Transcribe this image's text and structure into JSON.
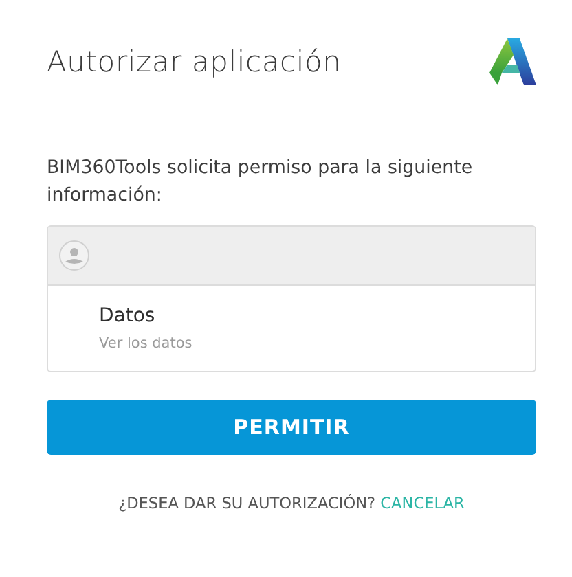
{
  "title": "Autorizar aplicación",
  "intro": "BIM360Tools solicita permiso para la siguiente información:",
  "scopes": [
    {
      "name": "Datos",
      "description": "Ver los datos"
    }
  ],
  "allow_button": "PERMITIR",
  "footer": {
    "question": "¿DESEA DAR SU AUTORIZACIÓN?",
    "cancel_link": "CANCELAR"
  }
}
